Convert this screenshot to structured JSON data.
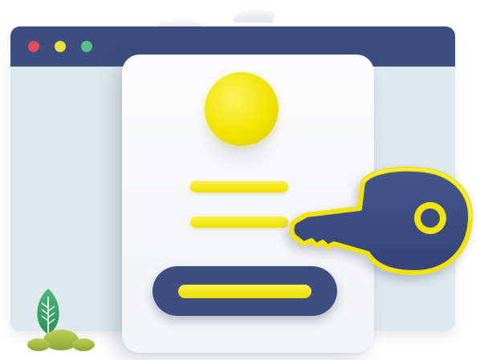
{
  "colors": {
    "window_bg": "#dde9ee",
    "titlebar": "#3d4e80",
    "close_dot": "#e84a58",
    "minimize_dot": "#e5e035",
    "maximize_dot": "#58c08c",
    "card_bg": "#f6f6f8",
    "accent_yellow": "#f2e400",
    "key_fill": "#3d4e80",
    "plant_green": "#3aa466",
    "bush_green": "#a7be45"
  },
  "icons": {
    "key": "key-icon",
    "avatar": "user-avatar-placeholder",
    "plant": "plant-icon",
    "cloud": "cloud-icon"
  }
}
